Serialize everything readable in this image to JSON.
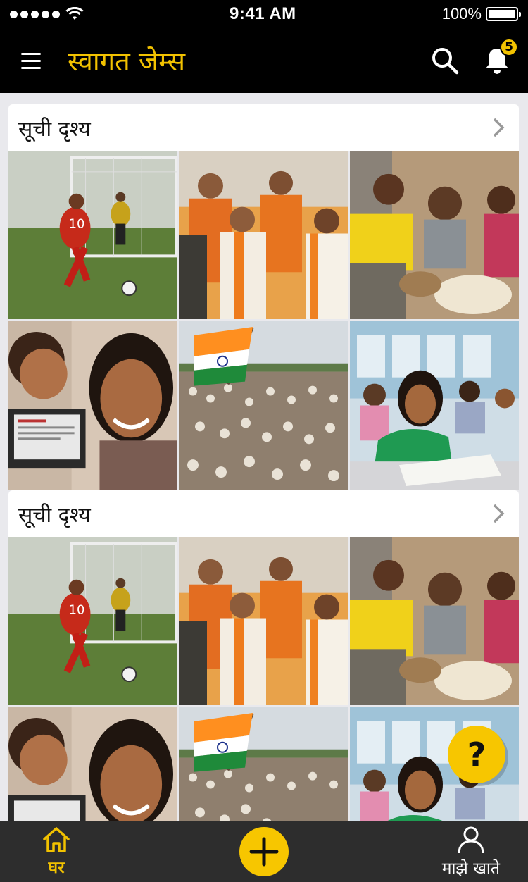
{
  "status_bar": {
    "time": "9:41 AM",
    "battery": "100%"
  },
  "header": {
    "title": "स्वागत जेम्स",
    "notification_count": "5"
  },
  "sections": [
    {
      "title": "सूची दृश्य",
      "tiles": [
        "soccer-player-photo",
        "leaders-greeting-photo",
        "women-children-photo",
        "smiling-girl-photo",
        "rally-crowd-flag-photo",
        "student-reading-photo"
      ]
    },
    {
      "title": "सूची दृश्य",
      "tiles": [
        "soccer-player-photo",
        "leaders-greeting-photo",
        "women-children-photo",
        "smiling-girl-photo",
        "rally-crowd-flag-photo",
        "student-reading-photo"
      ]
    }
  ],
  "help": {
    "label": "?"
  },
  "bottom_nav": {
    "home_label": "घर",
    "account_label": "माझे खाते"
  },
  "colors": {
    "accent": "#f2c200",
    "header_bg": "#000000",
    "nav_bg": "#2d2d2d",
    "page_bg": "#e9e9ed"
  },
  "icons": [
    "menu-icon",
    "search-icon",
    "bell-icon",
    "chevron-right-icon",
    "help-icon",
    "home-icon",
    "plus-icon",
    "user-icon"
  ]
}
